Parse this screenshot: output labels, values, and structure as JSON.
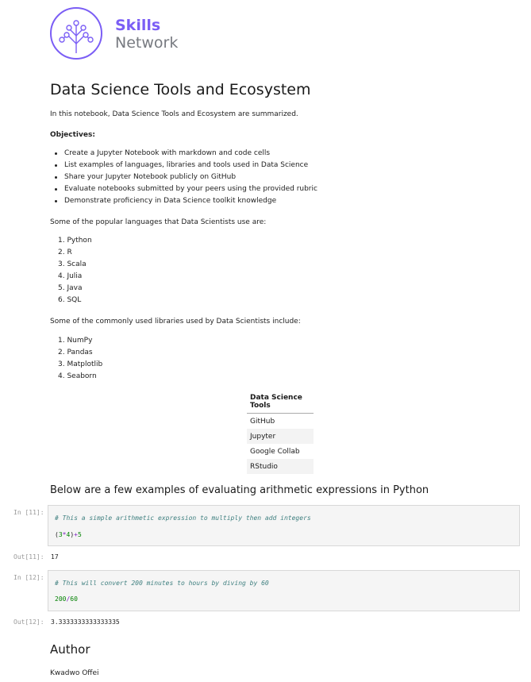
{
  "logo": {
    "line1": "Skills",
    "line2": "Network",
    "brand_color": "#7b5ef5"
  },
  "title": "Data Science Tools and Ecosystem",
  "intro": "In this notebook, Data Science Tools and Ecosystem are summarized.",
  "objectives_heading": "Objectives:",
  "objectives": [
    "Create a Jupyter Notebook with markdown and code cells",
    "List examples of languages, libraries and tools used in Data Science",
    "Share your Jupyter Notebook publicly on GitHub",
    "Evaluate notebooks submitted by your peers using the provided rubric",
    "Demonstrate proficiency in Data Science toolkit knowledge"
  ],
  "languages_intro": "Some of the popular languages that Data Scientists use are:",
  "languages": [
    "1. Python",
    "2. R",
    "3. Scala",
    "4. Julia",
    "5. Java",
    "6. SQL"
  ],
  "libraries_intro": "Some of the commonly used libraries used by Data Scientists include:",
  "libraries": [
    "1. NumPy",
    "2. Pandas",
    "3. Matplotlib",
    "4. Seaborn"
  ],
  "tools_table": {
    "header": "Data Science Tools",
    "rows": [
      "GitHub",
      "Jupyter",
      "Google Collab",
      "RStudio"
    ]
  },
  "arith_heading": "Below are a few examples of evaluating arithmetic expressions in Python",
  "cells": [
    {
      "in_prompt": "In [11]:",
      "comment": "# This a simple arithmetic expression to multiply then add integers",
      "code": {
        "p1": "(",
        "n1": "3",
        "op1": "*",
        "n2": "4",
        "p2": ")",
        "op2": "+",
        "n3": "5"
      },
      "out_prompt": "Out[11]:",
      "output": "17"
    },
    {
      "in_prompt": "In [12]:",
      "comment": "# This will convert 200 minutes to hours by diving by 60",
      "code": {
        "n1": "200",
        "op1": "/",
        "n2": "60"
      },
      "out_prompt": "Out[12]:",
      "output": "3.3333333333333335"
    }
  ],
  "author_heading": "Author",
  "author_name": "Kwadwo Offei"
}
